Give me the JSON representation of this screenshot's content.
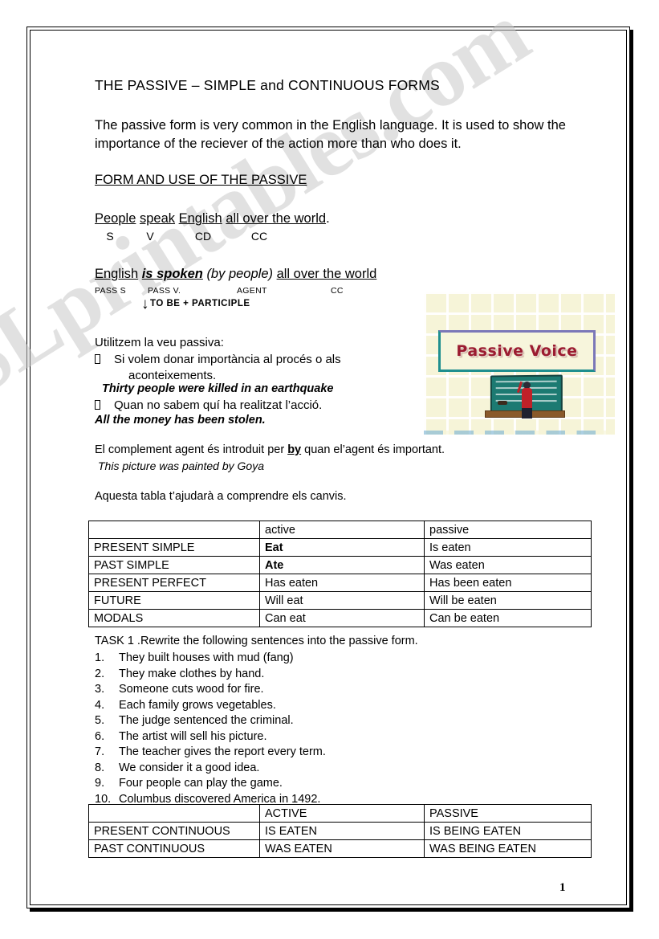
{
  "document": {
    "title": "THE PASSIVE – SIMPLE  and CONTINUOUS FORMS",
    "intro": "The passive form is very common in the English language. It is used to show the importance of the reciever of the action more than who does it.",
    "section_heading": "FORM AND USE OF THE PASSIVE",
    "page_number": "1",
    "watermark": "ESLprintables.com"
  },
  "example_active": {
    "w1": "People",
    "w2": "speak",
    "w3": "English",
    "w4": "all over the world",
    "period": ".",
    "labels": [
      "S",
      "V",
      "CD",
      "CC"
    ]
  },
  "example_passive": {
    "subject": "English",
    "verb": "is spoken",
    "agent": "(by people)",
    "complement": "all over the world",
    "labels": [
      "PASS S",
      "PASS V.",
      "AGENT",
      "CC"
    ],
    "arrow_note": "TO BE + PARTICIPLE",
    "arrow_glyph": "↓"
  },
  "catalan": {
    "heading": "Utilitzem la veu passiva:",
    "bullet1_line1": "Si volem donar importància al procés o als",
    "bullet1_line2": "aconteixements.",
    "example1": "Thirty people were killed in an earthquake",
    "bullet2": "Quan no sabem quí ha realitzat l’acció.",
    "example2": "All the money has been stolen.",
    "agent_note_pre": "El complement agent és introduit per ",
    "agent_note_by": "by",
    "agent_note_post": " quan el’agent és important.",
    "agent_example": "This picture was painted by Goya",
    "table_intro": "Aquesta tabla t’ajudarà a comprendre els canvis."
  },
  "clipart": {
    "banner_text": "Passive Voice",
    "alt": "passive-voice-chalkboard-clipart",
    "colors": {
      "background": "#f6f4d8",
      "banner_text": "#9b1b30",
      "border_teal": "#1f8f8f",
      "border_purple": "#7b77b8",
      "chalkboard": "#1c7a72"
    }
  },
  "table_simple": {
    "headers": [
      "",
      "active",
      "passive"
    ],
    "rows": [
      {
        "tense": "PRESENT SIMPLE",
        "active": "Eat",
        "passive": "Is eaten",
        "bold_active": true
      },
      {
        "tense": "PAST SIMPLE",
        "active": "Ate",
        "passive": "Was eaten",
        "bold_active": true
      },
      {
        "tense": "PRESENT PERFECT",
        "active": "Has eaten",
        "passive": "Has been eaten",
        "bold_active": false
      },
      {
        "tense": "FUTURE",
        "active": "Will eat",
        "passive": "Will be eaten",
        "bold_active": false
      },
      {
        "tense": "MODALS",
        "active": "Can eat",
        "passive": "Can be eaten",
        "bold_active": false
      }
    ]
  },
  "task": {
    "heading": "TASK 1 .Rewrite the following sentences into the passive form.",
    "items": [
      {
        "n": "1.",
        "text": "They built houses with mud (fang)"
      },
      {
        "n": "2.",
        "text": "They make clothes by hand."
      },
      {
        "n": "3.",
        "text": "Someone cuts wood for fire."
      },
      {
        "n": "4.",
        "text": "Each family grows vegetables."
      },
      {
        "n": "5.",
        "text": "The judge sentenced the criminal."
      },
      {
        "n": "6.",
        "text": "The artist will sell his picture."
      },
      {
        "n": "7.",
        "text": "The teacher gives the report every term."
      },
      {
        "n": "8.",
        "text": "We consider it a good idea."
      },
      {
        "n": "9.",
        "text": "Four people can play the game."
      },
      {
        "n": "10.",
        "text": "Columbus discovered America in 1492."
      }
    ]
  },
  "table_continuous": {
    "headers": [
      "",
      "ACTIVE",
      "PASSIVE"
    ],
    "rows": [
      {
        "tense": "PRESENT CONTINUOUS",
        "active": "IS EATEN",
        "passive": "IS BEING EATEN"
      },
      {
        "tense": "PAST CONTINUOUS",
        "active": "WAS EATEN",
        "passive": "WAS BEING EATEN"
      }
    ]
  }
}
